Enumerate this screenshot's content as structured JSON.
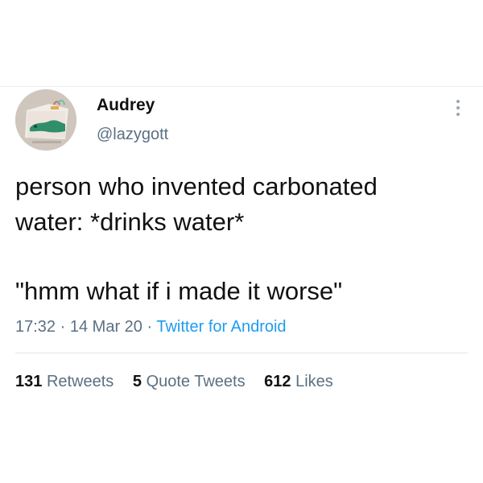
{
  "tweet": {
    "author": {
      "display_name": "Audrey",
      "handle": "@lazygott",
      "avatar_icon": "avatar-icon"
    },
    "text_lines": [
      "person who invented carbonated",
      "water: *drinks water*",
      "\"hmm what if i made it worse\""
    ],
    "meta": {
      "time": "17:32",
      "separator": "·",
      "date": "14 Mar 20",
      "source": "Twitter for Android"
    },
    "stats": [
      {
        "value": "131",
        "label": "Retweets"
      },
      {
        "value": "5",
        "label": "Quote Tweets"
      },
      {
        "value": "612",
        "label": "Likes"
      }
    ],
    "more_icon": "more-vertical-icon"
  },
  "colors": {
    "primary_text": "#111111",
    "secondary_text": "#5b7083",
    "link": "#1d9bf0",
    "divider": "#e1e8ed"
  }
}
